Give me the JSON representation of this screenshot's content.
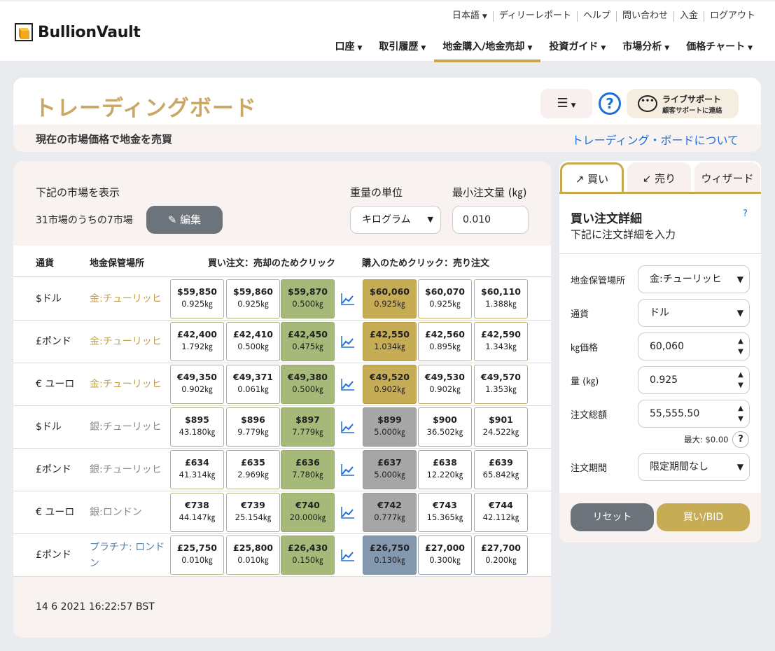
{
  "header": {
    "brand": "BullionVault",
    "top_links": [
      "日本語",
      "ディリーレポート",
      "ヘルプ",
      "問い合わせ",
      "入金",
      "ログアウト"
    ],
    "nav": [
      "口座",
      "取引履歴",
      "地金購入/地金売却",
      "投資ガイド",
      "市場分析",
      "価格チャート"
    ]
  },
  "title": {
    "heading": "トレーディングボード",
    "subtitle": "現在の市場価格で地金を売買",
    "about_link": "トレーディング・ボードについて",
    "live_support": "ライブサポート",
    "live_support_sub": "顧客サポートに連絡",
    "help_symbol": "?"
  },
  "board": {
    "show_label": "下記の市場を表示",
    "market_count": "31市場のうちの7市場",
    "edit_button": "編集",
    "weight_unit_label": "重量の単位",
    "weight_unit_value": "キログラム",
    "min_order_label": "最小注文量 (㎏)",
    "min_order_value": "0.010",
    "columns": {
      "currency": "通貨",
      "vault": "地金保管場所",
      "bids": "買い注文：売却のためクリック",
      "asks": "購入のためクリック：売り注文"
    },
    "rows": [
      {
        "currency": "$ドル",
        "vault": "金:チューリッヒ",
        "metal": "gold",
        "bids": [
          {
            "p": "$59,850",
            "w": "0.925㎏"
          },
          {
            "p": "$59,860",
            "w": "0.925㎏"
          },
          {
            "p": "$59,870",
            "w": "0.500㎏"
          }
        ],
        "asks": [
          {
            "p": "$60,060",
            "w": "0.925㎏"
          },
          {
            "p": "$60,070",
            "w": "0.925㎏"
          },
          {
            "p": "$60,110",
            "w": "1.388㎏"
          }
        ]
      },
      {
        "currency": "£ポンド",
        "vault": "金:チューリッヒ",
        "metal": "gold",
        "bids": [
          {
            "p": "£42,400",
            "w": "1.792㎏"
          },
          {
            "p": "£42,410",
            "w": "0.500㎏"
          },
          {
            "p": "£42,450",
            "w": "0.475㎏"
          }
        ],
        "asks": [
          {
            "p": "£42,550",
            "w": "1.034㎏"
          },
          {
            "p": "£42,560",
            "w": "0.895㎏"
          },
          {
            "p": "£42,590",
            "w": "1.343㎏"
          }
        ]
      },
      {
        "currency": "€ ユーロ",
        "vault": "金:チューリッヒ",
        "metal": "gold",
        "bids": [
          {
            "p": "€49,350",
            "w": "0.902㎏"
          },
          {
            "p": "€49,371",
            "w": "0.061㎏"
          },
          {
            "p": "€49,380",
            "w": "0.500㎏"
          }
        ],
        "asks": [
          {
            "p": "€49,520",
            "w": "0.902㎏"
          },
          {
            "p": "€49,530",
            "w": "0.902㎏"
          },
          {
            "p": "€49,570",
            "w": "1.353㎏"
          }
        ]
      },
      {
        "currency": "$ドル",
        "vault": "銀:チューリッヒ",
        "metal": "silver",
        "bids": [
          {
            "p": "$895",
            "w": "43.180㎏"
          },
          {
            "p": "$896",
            "w": "9.779㎏"
          },
          {
            "p": "$897",
            "w": "7.779㎏"
          }
        ],
        "asks": [
          {
            "p": "$899",
            "w": "5.000㎏"
          },
          {
            "p": "$900",
            "w": "36.502㎏"
          },
          {
            "p": "$901",
            "w": "24.522㎏"
          }
        ]
      },
      {
        "currency": "£ポンド",
        "vault": "銀:チューリッヒ",
        "metal": "silver",
        "bids": [
          {
            "p": "£634",
            "w": "41.314㎏"
          },
          {
            "p": "£635",
            "w": "2.969㎏"
          },
          {
            "p": "£636",
            "w": "7.780㎏"
          }
        ],
        "asks": [
          {
            "p": "£637",
            "w": "5.000㎏"
          },
          {
            "p": "£638",
            "w": "12.220㎏"
          },
          {
            "p": "£639",
            "w": "65.842㎏"
          }
        ]
      },
      {
        "currency": "€ ユーロ",
        "vault": "銀:ロンドン",
        "metal": "silver",
        "bids": [
          {
            "p": "€738",
            "w": "44.147㎏"
          },
          {
            "p": "€739",
            "w": "25.154㎏"
          },
          {
            "p": "€740",
            "w": "20.000㎏"
          }
        ],
        "asks": [
          {
            "p": "€742",
            "w": "0.777㎏"
          },
          {
            "p": "€743",
            "w": "15.365㎏"
          },
          {
            "p": "€744",
            "w": "42.112㎏"
          }
        ]
      },
      {
        "currency": "£ポンド",
        "vault": "プラチナ: ロンドン",
        "metal": "plat",
        "bids": [
          {
            "p": "£25,750",
            "w": "0.010㎏"
          },
          {
            "p": "£25,800",
            "w": "0.010㎏"
          },
          {
            "p": "£26,430",
            "w": "0.150㎏"
          }
        ],
        "asks": [
          {
            "p": "£26,750",
            "w": "0.130㎏"
          },
          {
            "p": "£27,000",
            "w": "0.300㎏"
          },
          {
            "p": "£27,700",
            "w": "0.200㎏"
          }
        ]
      }
    ],
    "timestamp": "14 6 2021 16:22:57 BST"
  },
  "order_panel": {
    "tabs": [
      "買い",
      "売り",
      "ウィザード"
    ],
    "title": "買い注文詳細",
    "subtitle": "下記に注文詳細を入力",
    "help": "?",
    "fields": {
      "vault_label": "地金保管場所",
      "vault_value": "金:チューリッヒ",
      "currency_label": "通貨",
      "currency_value": "ドル",
      "price_label": "㎏価格",
      "price_value": "60,060",
      "qty_label": "量 (㎏)",
      "qty_value": "0.925",
      "total_label": "注文総額",
      "total_value": "55,555.50",
      "max_label": "最大: $0.00",
      "term_label": "注文期間",
      "term_value": "限定期間なし"
    },
    "reset_button": "リセット",
    "buy_button": "買い/BID"
  },
  "colors": {
    "gold_accent": "#c8a84b",
    "bid_fill": "#a6b978",
    "link_blue": "#1e6fd9",
    "button_grey": "#6c737b"
  }
}
